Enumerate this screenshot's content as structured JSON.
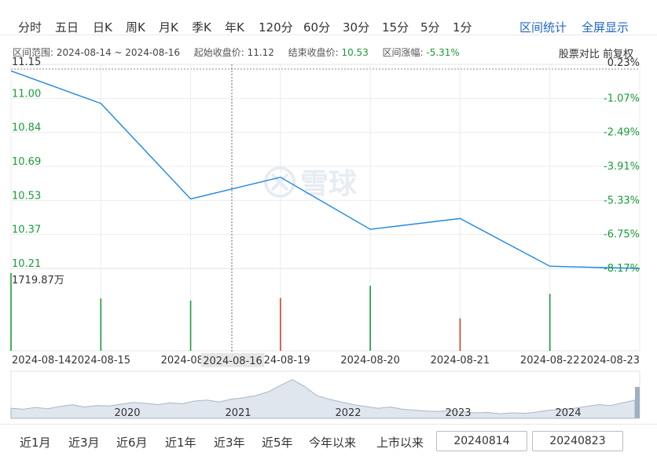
{
  "tabs": [
    "分时",
    "五日",
    "日K",
    "周K",
    "月K",
    "季K",
    "年K",
    "120分",
    "60分",
    "30分",
    "15分",
    "5分",
    "1分"
  ],
  "tools": {
    "stats": "区间统计",
    "fullscreen": "全屏显示"
  },
  "info": {
    "range_label": "区间范围:",
    "range_value": "2024-08-14 ~ 2024-08-16",
    "open_label": "起始收盘价:",
    "open_value": "11.12",
    "close_label": "结束收盘价:",
    "close_value": "10.53",
    "change_label": "区间涨幅:",
    "change_value": "-5.31%",
    "compare": "股票对比",
    "adjust": "前复权"
  },
  "watermark": "雪球",
  "volume_max_label": "1719.87万",
  "crosshair_label": "2024-08-16",
  "colors": {
    "line": "#1e88e5",
    "up": "#d44020",
    "down": "#1a9c3a",
    "accent": "#1f66c9"
  },
  "chart_data": {
    "type": "line",
    "x": [
      "2024-08-14",
      "2024-08-15",
      "2024-08-16",
      "2024-08-19",
      "2024-08-20",
      "2024-08-21",
      "2024-08-22",
      "2024-08-23"
    ],
    "series": [
      {
        "values": [
          11.12,
          10.97,
          10.53,
          10.63,
          10.39,
          10.44,
          10.22,
          10.21
        ]
      }
    ],
    "volume": {
      "values": [
        1719.87,
        1160,
        1110,
        1170,
        1440,
        720,
        1260,
        0
      ],
      "direction": [
        "down",
        "down",
        "down",
        "up",
        "down",
        "up",
        "down",
        "down"
      ]
    },
    "yticks_left": [
      "11.15",
      "11.00",
      "10.84",
      "10.69",
      "10.53",
      "10.37",
      "10.21"
    ],
    "yticks_right": [
      "0.23%",
      "-1.07%",
      "-2.49%",
      "-3.91%",
      "-5.33%",
      "-6.75%",
      "-8.17%"
    ],
    "ylim": [
      10.21,
      11.15
    ],
    "xtick_labels": [
      "2024-08-14",
      "2024-08-15",
      "2024-08",
      "2024-08-19",
      "2024-08-20",
      "2024-08-21",
      "2024-08-22",
      "2024-08-23"
    ],
    "overview_years": [
      "2020",
      "2021",
      "2022",
      "2023",
      "2024"
    ]
  },
  "ranges": [
    "近1月",
    "近3月",
    "近6月",
    "近1年",
    "近3年",
    "近5年",
    "今年以来",
    "上市以来"
  ],
  "date_start": "20240814",
  "date_end": "20240823"
}
